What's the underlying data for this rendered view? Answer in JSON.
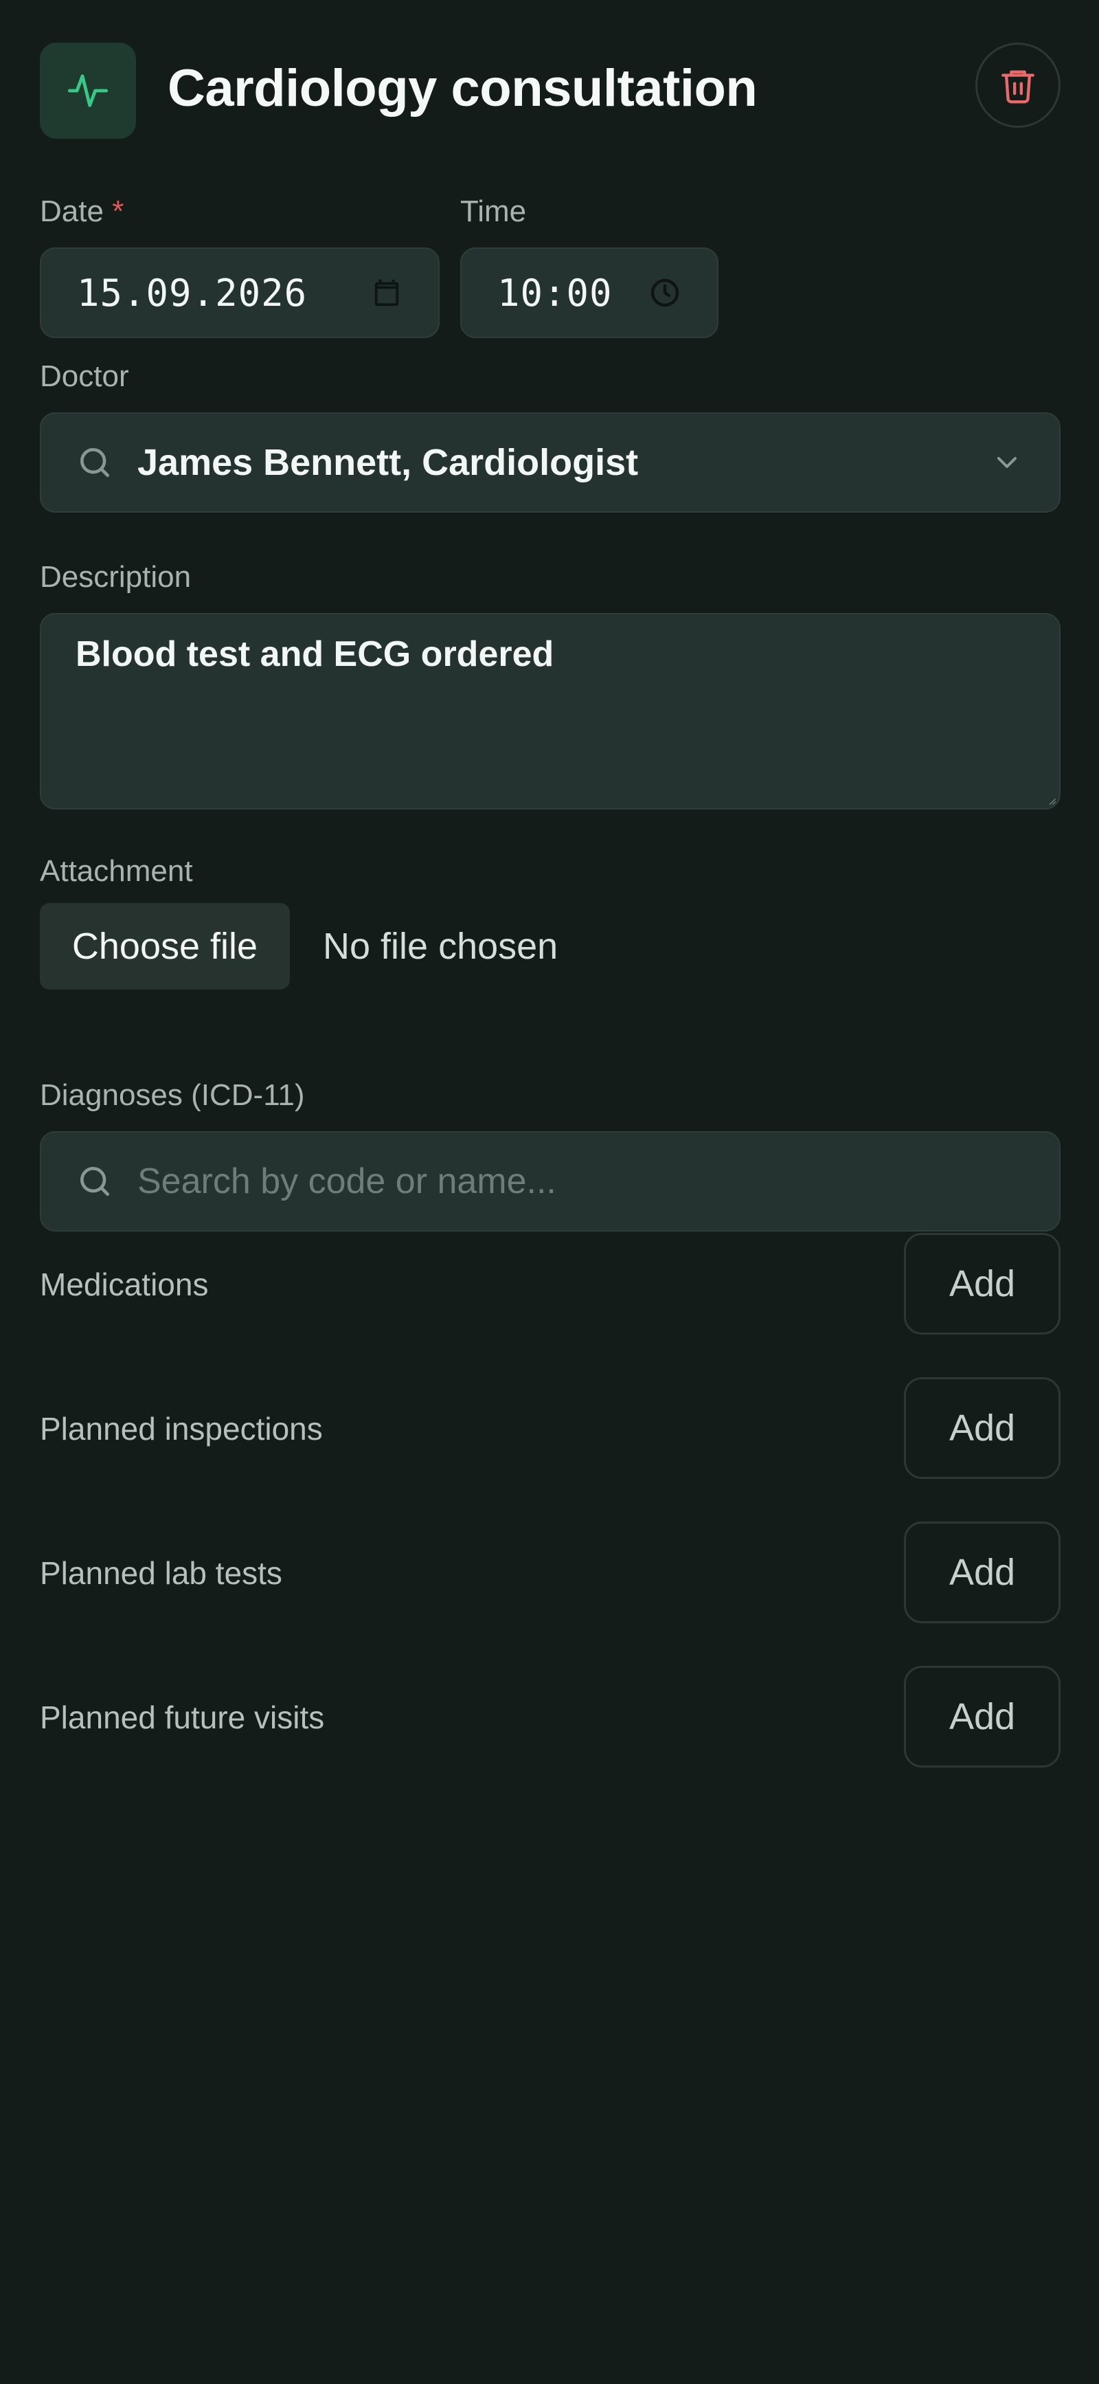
{
  "header": {
    "title": "Cardiology consultation",
    "app_icon": "activity-pulse-icon",
    "delete_icon": "trash-icon",
    "accent_color": "#37c986",
    "danger_color": "#e86a6a"
  },
  "form": {
    "date": {
      "label": "Date",
      "required_mark": "*",
      "value": "15.09.2026",
      "icon": "calendar-icon"
    },
    "time": {
      "label": "Time",
      "value": "10:00",
      "icon": "clock-icon"
    },
    "doctor": {
      "label": "Doctor",
      "value": "James Bennett, Cardiologist",
      "search_icon": "search-icon",
      "dropdown_icon": "chevron-down-icon"
    },
    "description": {
      "label": "Description",
      "value": "Blood test and ECG ordered"
    },
    "attachment": {
      "label": "Attachment",
      "button_label": "Choose file",
      "status": "No file chosen"
    },
    "diagnoses": {
      "label": "Diagnoses (ICD-11)",
      "placeholder": "Search by code or name..."
    }
  },
  "sections": [
    {
      "label": "Medications",
      "button_label": "Add"
    },
    {
      "label": "Planned inspections",
      "button_label": "Add"
    },
    {
      "label": "Planned lab tests",
      "button_label": "Add"
    },
    {
      "label": "Planned future visits",
      "button_label": "Add"
    }
  ]
}
